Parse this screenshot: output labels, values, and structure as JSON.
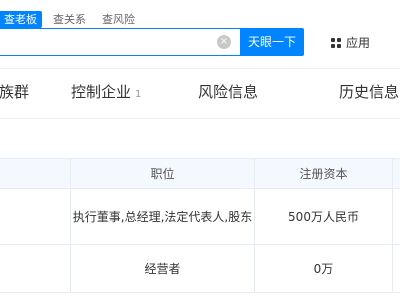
{
  "search": {
    "tabs": [
      "查老板",
      "查关系",
      "查风险"
    ],
    "query": "",
    "button_label": "天眼一下"
  },
  "apps": {
    "label": "应用"
  },
  "nav": {
    "items": [
      {
        "label": "族群"
      },
      {
        "label": "控制企业",
        "count": "1"
      },
      {
        "label": "风险信息"
      },
      {
        "label": "历史信息"
      }
    ]
  },
  "table": {
    "headers": {
      "position": "职位",
      "capital": "注册资本"
    },
    "rows": [
      {
        "position": "执行董事,总经理,法定代表人,股东",
        "capital": "500万人民币"
      },
      {
        "position": "经营者",
        "capital": "0万"
      }
    ]
  },
  "colors": {
    "accent": "#0084ff",
    "table_header_bg": "#f4f8ff"
  },
  "icons": {
    "clear": "clear-circle-icon",
    "apps": "grid-icon"
  }
}
